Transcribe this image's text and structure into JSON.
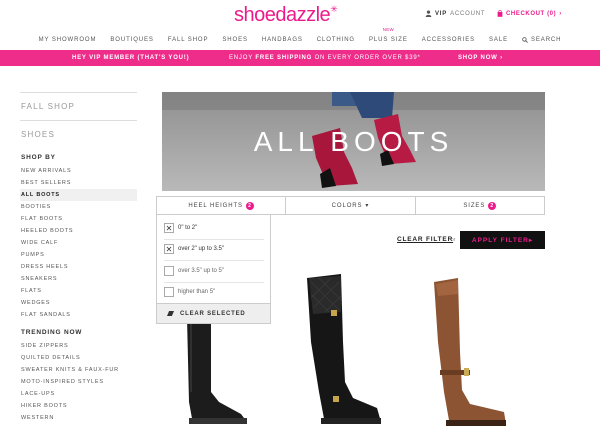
{
  "header": {
    "logo": "shoedazzle",
    "account": {
      "bold": "VIP",
      "rest": "ACCOUNT"
    },
    "checkout": "CHECKOUT (0)"
  },
  "nav": {
    "items": [
      {
        "label": "MY SHOWROOM"
      },
      {
        "label": "BOUTIQUES"
      },
      {
        "label": "FALL SHOP"
      },
      {
        "label": "SHOES"
      },
      {
        "label": "HANDBAGS"
      },
      {
        "label": "CLOTHING"
      },
      {
        "label": "PLUS SIZE",
        "tag": "NEW"
      },
      {
        "label": "ACCESSORIES"
      },
      {
        "label": "SALE"
      },
      {
        "label": "SEARCH"
      }
    ]
  },
  "promo": {
    "left": "HEY VIP MEMBER (THAT'S YOU!)",
    "middle_pre": "ENJOY ",
    "middle_bold": "FREE SHIPPING",
    "middle_post": " ON EVERY ORDER OVER $39*",
    "right": "SHOP NOW ›"
  },
  "sidebar": {
    "section1": "FALL SHOP",
    "section2": "SHOES",
    "shop_by": "SHOP BY",
    "shop_by_links": [
      "NEW ARRIVALS",
      "BEST SELLERS",
      "ALL BOOTS",
      "BOOTIES",
      "FLAT BOOTS",
      "HEELED BOOTS",
      "WIDE CALF",
      "PUMPS",
      "DRESS HEELS",
      "SNEAKERS",
      "FLATS",
      "WEDGES",
      "FLAT SANDALS"
    ],
    "active_link": "ALL BOOTS",
    "trending": "TRENDING NOW",
    "trending_links": [
      "SIDE ZIPPERS",
      "QUILTED DETAILS",
      "SWEATER KNITS & FAUX-FUR",
      "MOTO-INSPIRED STYLES",
      "LACE-UPS",
      "HIKER BOOTS",
      "WESTERN"
    ]
  },
  "hero": {
    "title": "ALL BOOTS"
  },
  "filters": {
    "heel": {
      "label": "HEEL HEIGHTS",
      "count": "2"
    },
    "colors": {
      "label": "COLORS",
      "arrow": "▾"
    },
    "sizes": {
      "label": "SIZES",
      "count": "2"
    }
  },
  "heel_options": [
    {
      "label": "0\" to 2\"",
      "checked": true,
      "mark": "✕"
    },
    {
      "label": "over 2\" up to 3.5\"",
      "checked": true,
      "mark": "✕"
    },
    {
      "label": "over 3.5\" up to 5\"",
      "checked": false,
      "mark": ""
    },
    {
      "label": "higher than 5\"",
      "checked": false,
      "mark": ""
    }
  ],
  "clear_selected": "CLEAR SELECTED",
  "clear_filter": "CLEAR FILTER",
  "or": "or",
  "apply_filter": "APPLY FILTER▸",
  "colors": {
    "brand": "#ec1b8c",
    "promo": "#ee2d8a"
  }
}
